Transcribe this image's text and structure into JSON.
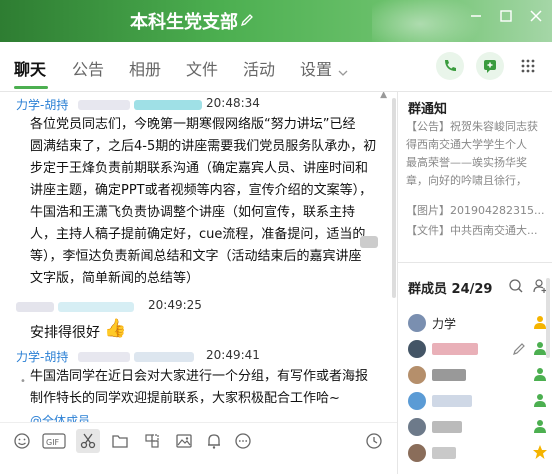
{
  "window": {
    "title": "本科生党支部"
  },
  "tabs": [
    {
      "label": "聊天"
    },
    {
      "label": "公告"
    },
    {
      "label": "相册"
    },
    {
      "label": "文件"
    },
    {
      "label": "活动"
    },
    {
      "label": "设置"
    }
  ],
  "colors": {
    "accent": "#4caf50",
    "sender": "#2a7fd4",
    "title_bar": "#4caf50"
  },
  "messages": [
    {
      "sender": "力学-胡持",
      "time": "20:48:34",
      "lines": [
        "各位党员同志们，今晚第一期寒假网络版“努力讲坛”已经",
        "圆满结束了，之后4-5期的讲座需要我们党员服务队承办，初",
        "步定于王烽负责前期联系沟通（确定嘉宾人员、讲座时间和",
        "讲座主题，确定PPT或者视频等内容，宣传介绍的文案等），",
        "牛国浩和王潇飞负责协调整个讲座（如何宣传，联系主持",
        "人，主持人稿子提前确定好，cue流程，准备提问，适当的",
        "等），李恒达负责新闻总结和文字（活动结束后的嘉宾讲座",
        "文字版，简单新闻的总结等）"
      ]
    },
    {
      "time": "20:49:25",
      "text": "安排得很好"
    },
    {
      "sender": "力学-胡持",
      "time": "20:49:41",
      "lines": [
        "牛国浩同学在近日会对大家进行一个分组，有写作或者海报",
        "制作特长的同学欢迎提前联系，大家积极配合工作哈~",
        "@全体成员"
      ]
    }
  ],
  "sidebar": {
    "notice_title": "群通知",
    "notice_lines": [
      "【公告】祝贺朱容峻同志获",
      "得西南交通大学学生个人",
      "最高荣誉——竢实扬华奖",
      "章，向优秀党员同志学习",
      "【图片】201904282315...",
      "【文件】中共西南交通大..."
    ],
    "notice_line_3": "章，向好的吟啸且徐行，",
    "members_label": "群成员 24/29",
    "members": [
      {
        "name": "力学"
      }
    ]
  },
  "icons": [
    "edit-icon",
    "minimize-icon",
    "maximize-icon",
    "close-icon",
    "phone-icon",
    "message-plus-icon",
    "more-icon",
    "emoji-icon",
    "gif-icon",
    "scissors-icon",
    "folder-icon",
    "screenshot-icon",
    "image-icon",
    "bell-icon",
    "more-circle-icon",
    "history-icon",
    "search-icon",
    "add-member-icon"
  ]
}
